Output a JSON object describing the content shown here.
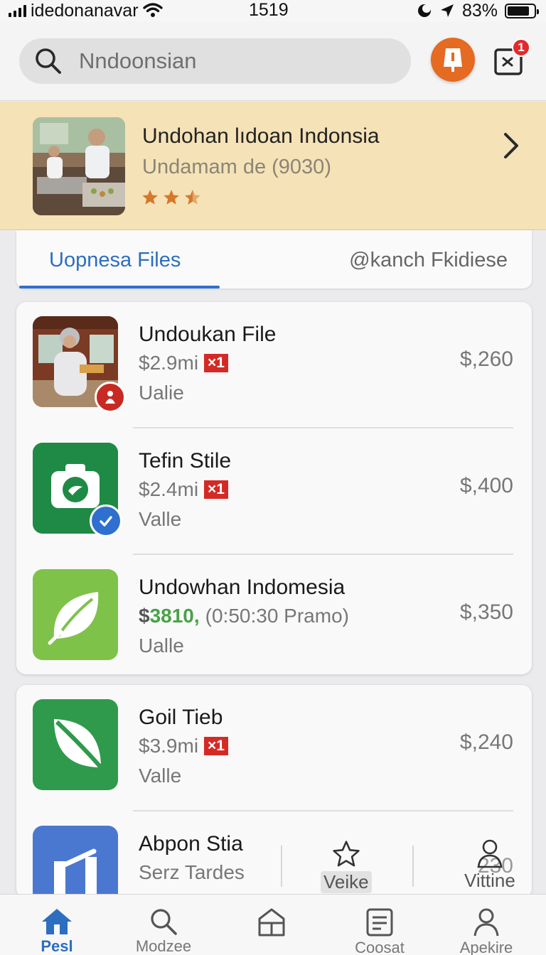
{
  "status_bar": {
    "carrier": "idedonanavar",
    "time": "1519",
    "battery": "83%",
    "battery_level": 0.83
  },
  "header": {
    "search_placeholder": "Nndoonsian",
    "cart_badge": "1",
    "alert_color": "#e56a22"
  },
  "banner": {
    "title": "Undohan lıdoan Indonsia",
    "subtitle": "Undamam de (9030)",
    "rating_stars": 2.5,
    "background": "#f5e2b7"
  },
  "tabs": {
    "active": "Uopnesa Files",
    "second": "@kanch Fkidiese"
  },
  "items": [
    {
      "name": "Undoukan File",
      "price": "$2.9mi",
      "tag": "×1",
      "condition": "Ualie",
      "amount": "$,260",
      "icon": "photo-thumbnail"
    },
    {
      "name": "Tefin Stile",
      "price": "$2.4mi",
      "tag": "×1",
      "condition": "Valle",
      "amount": "$,400",
      "icon": "camera-icon"
    },
    {
      "name": "Undowhan Indomesia",
      "price_prefix": "$",
      "price_highlight": "3810,",
      "price_note": "(0:50:30 Pramo)",
      "condition": "Ualle",
      "amount": "$,350",
      "icon": "leaf-icon"
    },
    {
      "name": "Goil Tieb",
      "price": "$3.9mi",
      "tag": "×1",
      "condition": "Valle",
      "amount": "$,240",
      "icon": "leaf-icon"
    },
    {
      "name": "Abpon Stia",
      "price": "Serz Tardes",
      "amount": "230",
      "icon": "chart-icon"
    }
  ],
  "overlay_actions": {
    "fav_label": "Veike",
    "profile_label": "Vittine"
  },
  "bottom_nav": [
    {
      "label": "Pesl",
      "icon": "home-icon"
    },
    {
      "label": "Modzee",
      "icon": "search-icon"
    },
    {
      "label": "",
      "icon": "store-icon"
    },
    {
      "label": "Coosat",
      "icon": "list-icon"
    },
    {
      "label": "Apekire",
      "icon": "profile-icon"
    }
  ],
  "colors": {
    "accent": "#2d6ec0",
    "tag_red": "#d42a25",
    "promo_green": "#47a248"
  }
}
